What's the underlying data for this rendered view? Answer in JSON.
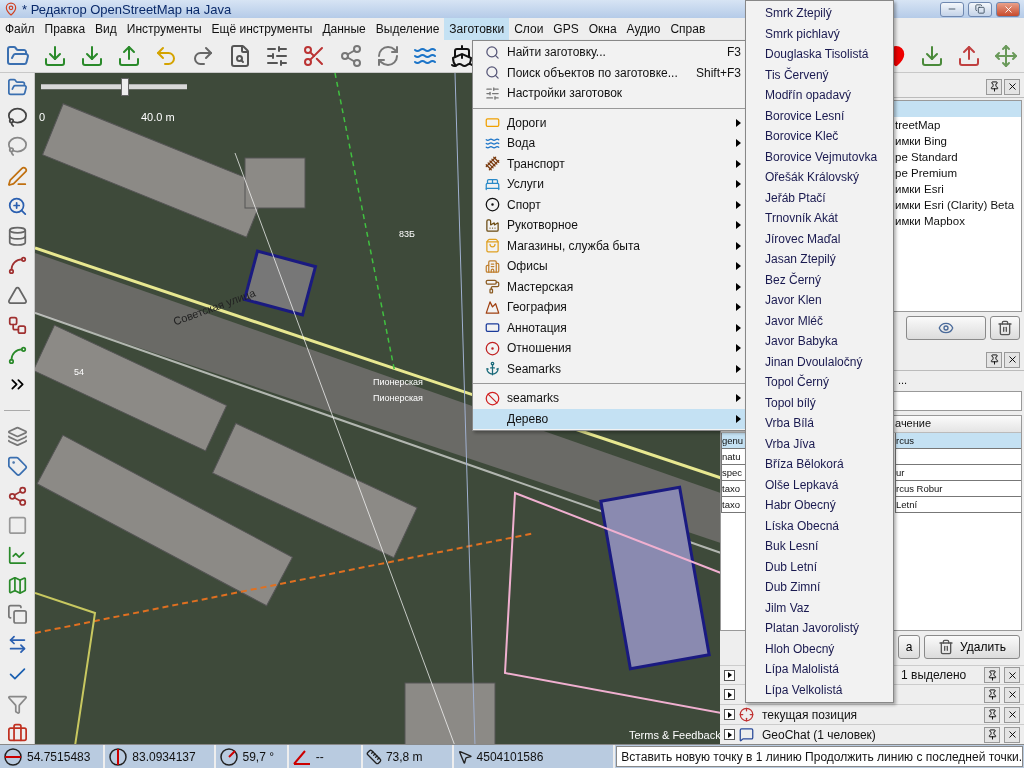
{
  "window": {
    "title": "* Редактор OpenStreetMap на Java"
  },
  "menu_bar": [
    {
      "label": "Файл",
      "selected": false
    },
    {
      "label": "Правка",
      "selected": false
    },
    {
      "label": "Вид",
      "selected": false
    },
    {
      "label": "Инструменты",
      "selected": false
    },
    {
      "label": "Ещё инструменты",
      "selected": false
    },
    {
      "label": "Данные",
      "selected": false
    },
    {
      "label": "Выделение",
      "selected": false
    },
    {
      "label": "Заготовки",
      "selected": true
    },
    {
      "label": "Слои",
      "selected": false
    },
    {
      "label": "GPS",
      "selected": false
    },
    {
      "label": "Окна",
      "selected": false
    },
    {
      "label": "Аудио",
      "selected": false
    },
    {
      "label": "Справ",
      "selected": false
    }
  ],
  "map": {
    "zoom_slider": {
      "level": 0.6
    },
    "labels": [
      "0",
      "40.0 m",
      "Советская улица",
      "Пионерская",
      "Пионерская",
      "83Б",
      "54",
      "Terms & Feedback"
    ]
  },
  "presets_menu": {
    "items": [
      {
        "kind": "action",
        "label": "Найти заготовку...",
        "shortcut": "F3"
      },
      {
        "kind": "action",
        "label": "Поиск объектов по заготовке...",
        "shortcut": "Shift+F3"
      },
      {
        "kind": "action",
        "label": "Настройки заготовок"
      },
      {
        "kind": "separator"
      },
      {
        "kind": "submenu",
        "label": "Дороги",
        "selected": false
      },
      {
        "kind": "submenu",
        "label": "Вода",
        "selected": false
      },
      {
        "kind": "submenu",
        "label": "Транспорт",
        "selected": false
      },
      {
        "kind": "submenu",
        "label": "Услуги",
        "selected": false
      },
      {
        "kind": "submenu",
        "label": "Спорт",
        "selected": false
      },
      {
        "kind": "submenu",
        "label": "Рукотворное",
        "selected": false
      },
      {
        "kind": "submenu",
        "label": "Магазины, служба быта",
        "selected": false
      },
      {
        "kind": "submenu",
        "label": "Офисы",
        "selected": false
      },
      {
        "kind": "submenu",
        "label": "Мастерская",
        "selected": false
      },
      {
        "kind": "submenu",
        "label": "География",
        "selected": false
      },
      {
        "kind": "submenu",
        "label": "Аннотация",
        "selected": false
      },
      {
        "kind": "submenu",
        "label": "Отношения",
        "selected": false
      },
      {
        "kind": "submenu",
        "label": "Seamarks",
        "selected": false
      },
      {
        "kind": "separator"
      },
      {
        "kind": "submenu",
        "label": "seamarks",
        "selected": false
      },
      {
        "kind": "submenu",
        "label": "Дерево",
        "selected": true
      }
    ]
  },
  "tree_submenu": {
    "items": [
      "Smrk Ztepilý",
      "Smrk pichlavý",
      "Douglaska Tisolistá",
      "Tis Červený",
      "Modřín opadavý",
      "Borovice Lesní",
      "Borovice Kleč",
      "Borovice Vejmutovka",
      "Ořešák Královský",
      "Jeřáb Ptačí",
      "Trnovník Akát",
      "Jírovec Maďal",
      "Jasan Ztepilý",
      "Bez Černý",
      "Javor Klen",
      "Javor Mléč",
      "Javor Babyka",
      "Jinan Dvoulaločný",
      "Topol Černý",
      "Topol bílý",
      "Vrba Bílá",
      "Vrba Jíva",
      "Bříza Bělokorá",
      "Olše Lepkavá",
      "Habr Obecný",
      "Líska Obecná",
      "Buk Lesní",
      "Dub Letní",
      "Dub Zimní",
      "Jilm Vaz",
      "Platan Javorolistý",
      "Hloh Obecný",
      "Lípa Malolistá",
      "Lípa Velkolistá"
    ]
  },
  "layers_panel": {
    "items": [
      "treetMap",
      "имки Bing",
      "ре Standard",
      "ре Premium",
      "имки Esri",
      "имки Esri (Clarity) Beta",
      "имки Mapbox"
    ]
  },
  "tags_panel": {
    "summary": "...",
    "column_header": "ачение",
    "rows": [
      {
        "key": "genu",
        "value": "rcus",
        "selected": true
      },
      {
        "key": "natu",
        "selected": false
      },
      {
        "key": "spec",
        "value": "ur",
        "selected": false
      },
      {
        "key": "taxo",
        "value": "rcus Robur",
        "selected": false
      },
      {
        "key": "taxo",
        "value": "Letní",
        "selected": false
      }
    ],
    "buttons": [
      "a",
      "Удалить"
    ]
  },
  "toggle_dialogs": [
    {
      "label": "1 выделено",
      "expanded": false
    },
    {
      "expanded": false
    },
    {
      "label": "текущая позиция",
      "expanded": false
    },
    {
      "label": "GeoChat (1 человек)",
      "expanded": false
    }
  ],
  "status_bar": {
    "latitude": "54.7515483",
    "longitude": "83.0934137",
    "heading": "59,7 °",
    "angle": "--",
    "distance": "73,8 m",
    "way_id": "4504101586",
    "message": "Вставить новую точку в 1 линию Продолжить линию с последней точки."
  }
}
